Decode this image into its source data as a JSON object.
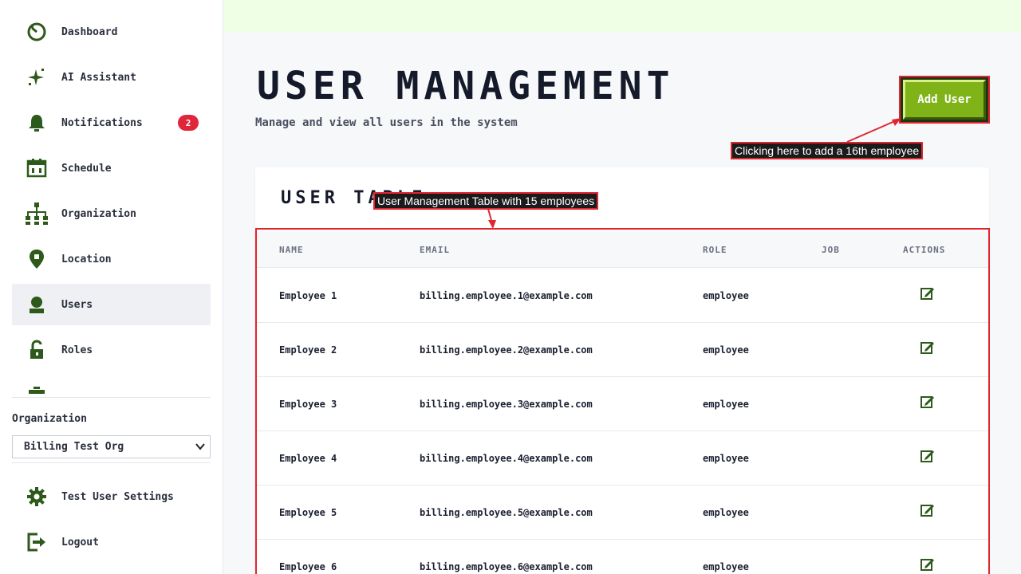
{
  "sidebar": {
    "items": [
      {
        "label": "Dashboard",
        "icon": "dashboard-icon"
      },
      {
        "label": "AI Assistant",
        "icon": "sparkle-icon"
      },
      {
        "label": "Notifications",
        "icon": "bell-icon",
        "badge": "2"
      },
      {
        "label": "Schedule",
        "icon": "calendar-icon"
      },
      {
        "label": "Organization",
        "icon": "org-chart-icon"
      },
      {
        "label": "Location",
        "icon": "location-pin-icon"
      },
      {
        "label": "Users",
        "icon": "user-icon",
        "active": true
      },
      {
        "label": "Roles",
        "icon": "lock-icon"
      }
    ],
    "organization_label": "Organization",
    "organization_value": "Billing Test Org",
    "settings_label": "Test User Settings",
    "logout_label": "Logout"
  },
  "header": {
    "title": "USER MANAGEMENT",
    "subtitle": "Manage and view all users in the system",
    "add_user_label": "Add User"
  },
  "table": {
    "title": "USER TABLE",
    "columns": [
      "NAME",
      "EMAIL",
      "ROLE",
      "JOB",
      "ACTIONS"
    ],
    "rows": [
      {
        "name": "Employee 1",
        "email": "billing.employee.1@example.com",
        "role": "employee",
        "job": ""
      },
      {
        "name": "Employee 2",
        "email": "billing.employee.2@example.com",
        "role": "employee",
        "job": ""
      },
      {
        "name": "Employee 3",
        "email": "billing.employee.3@example.com",
        "role": "employee",
        "job": ""
      },
      {
        "name": "Employee 4",
        "email": "billing.employee.4@example.com",
        "role": "employee",
        "job": ""
      },
      {
        "name": "Employee 5",
        "email": "billing.employee.5@example.com",
        "role": "employee",
        "job": ""
      },
      {
        "name": "Employee 6",
        "email": "billing.employee.6@example.com",
        "role": "employee",
        "job": ""
      }
    ]
  },
  "annotations": {
    "add_user_note": "Clicking here to add a 16th employee",
    "table_note": "User Management Table with 15 employees"
  },
  "colors": {
    "accent_green": "#2d5a1b",
    "button_green": "#7fb317",
    "badge_red": "#e0263b",
    "annotation_red": "#e0262e",
    "topbar": "#efffe6"
  }
}
